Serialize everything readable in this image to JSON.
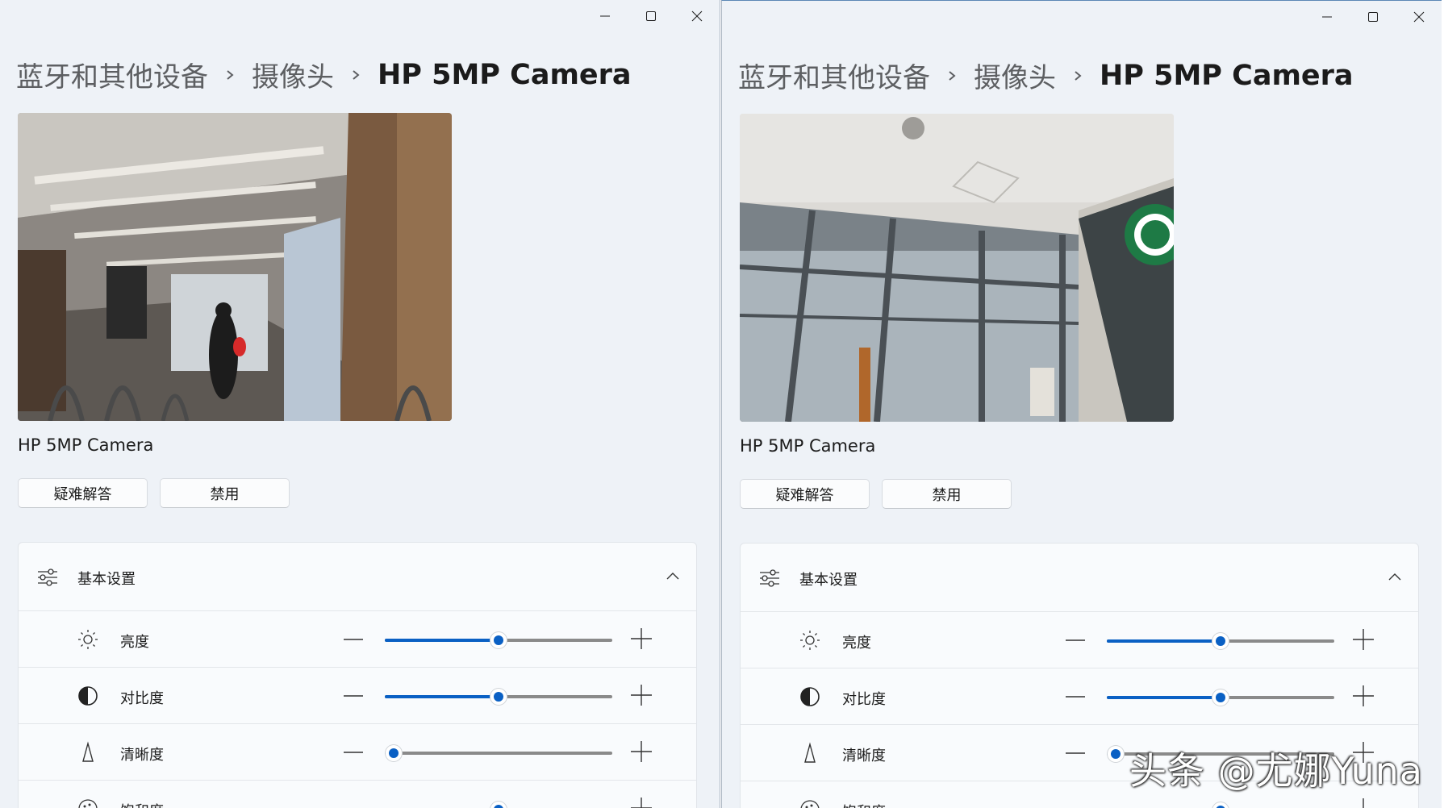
{
  "window_left": {
    "breadcrumb": {
      "item1": "蓝牙和其他设备",
      "item2": "摄像头",
      "current": "HP 5MP Camera"
    },
    "camera_name": "HP 5MP Camera",
    "buttons": {
      "troubleshoot": "疑难解答",
      "disable": "禁用"
    },
    "basic_settings": {
      "title": "基本设置",
      "rows": [
        {
          "label": "亮度",
          "icon": "sun-icon",
          "value_fraction": 0.5
        },
        {
          "label": "对比度",
          "icon": "contrast-icon",
          "value_fraction": 0.5
        },
        {
          "label": "清晰度",
          "icon": "sharpness-icon",
          "value_fraction": 0.04
        },
        {
          "label": "饱和度",
          "icon": "saturation-icon",
          "value_fraction": 0.5
        }
      ]
    }
  },
  "window_right": {
    "breadcrumb": {
      "item1": "蓝牙和其他设备",
      "item2": "摄像头",
      "current": "HP 5MP Camera"
    },
    "camera_name": "HP 5MP Camera",
    "buttons": {
      "troubleshoot": "疑难解答",
      "disable": "禁用"
    },
    "basic_settings": {
      "title": "基本设置",
      "rows": [
        {
          "label": "亮度",
          "icon": "sun-icon",
          "value_fraction": 0.5
        },
        {
          "label": "对比度",
          "icon": "contrast-icon",
          "value_fraction": 0.5
        },
        {
          "label": "清晰度",
          "icon": "sharpness-icon",
          "value_fraction": 0.04
        },
        {
          "label": "饱和度",
          "icon": "saturation-icon",
          "value_fraction": 0.5
        }
      ]
    }
  },
  "watermark": "头条 @尤娜Yuna",
  "colors": {
    "accent": "#0a60c4",
    "window_bg": "#eef2f7",
    "panel_bg": "#f9fbfd"
  }
}
